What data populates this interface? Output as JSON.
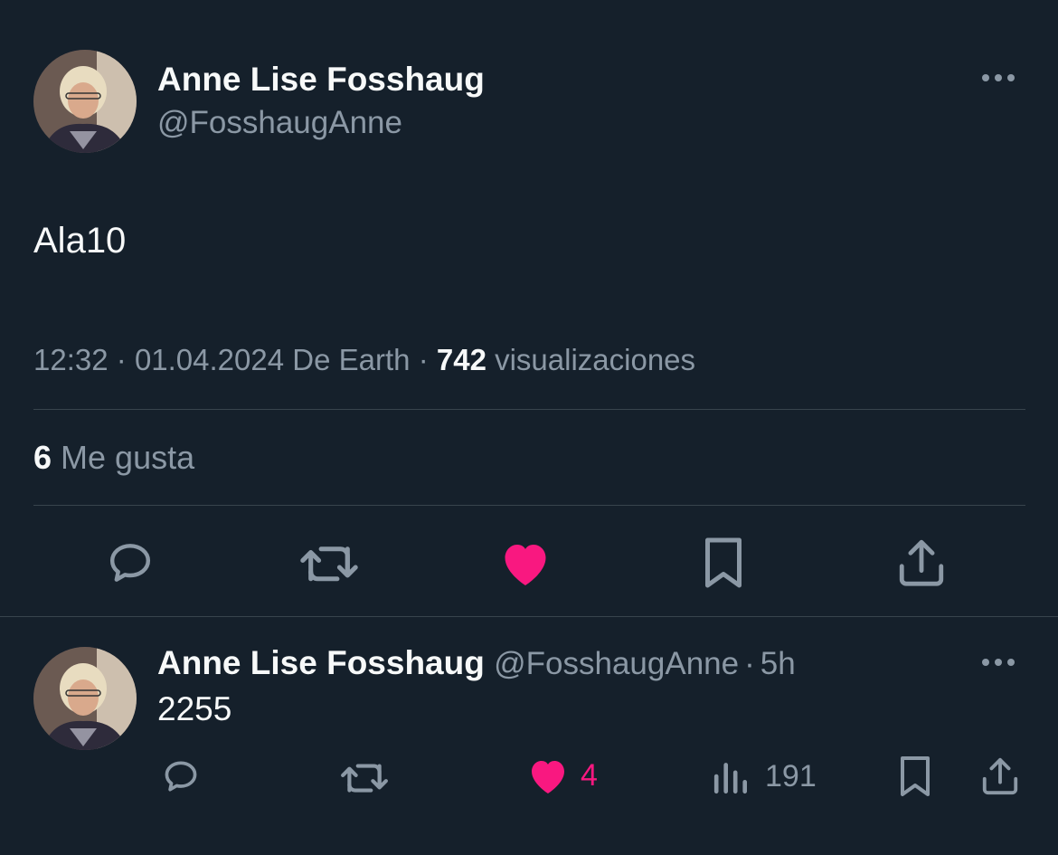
{
  "tweet": {
    "display_name": "Anne Lise Fosshaug",
    "handle": "@FosshaugAnne",
    "text": "Ala10",
    "time": "12:32",
    "sep1": "·",
    "date": "01.04.2024",
    "source": "De Earth",
    "sep2": "·",
    "views_count": "742",
    "views_label": "visualizaciones",
    "likes_count": "6",
    "likes_label": "Me gusta",
    "liked": true
  },
  "reply": {
    "display_name": "Anne Lise Fosshaug",
    "handle": "@FosshaugAnne",
    "sep": "·",
    "age": "5h",
    "text": "2255",
    "like_count": "4",
    "views_count": "191"
  },
  "colors": {
    "background": "#15202b",
    "text": "#f7f9f9",
    "muted": "#8b98a5",
    "like": "#f91880",
    "divider": "#38444d"
  },
  "icons": {
    "more": "more-horizontal-icon",
    "reply": "comment-icon",
    "retweet": "retweet-icon",
    "like": "heart-filled-icon",
    "bookmark": "bookmark-icon",
    "share": "share-icon",
    "views": "analytics-bar-icon"
  }
}
